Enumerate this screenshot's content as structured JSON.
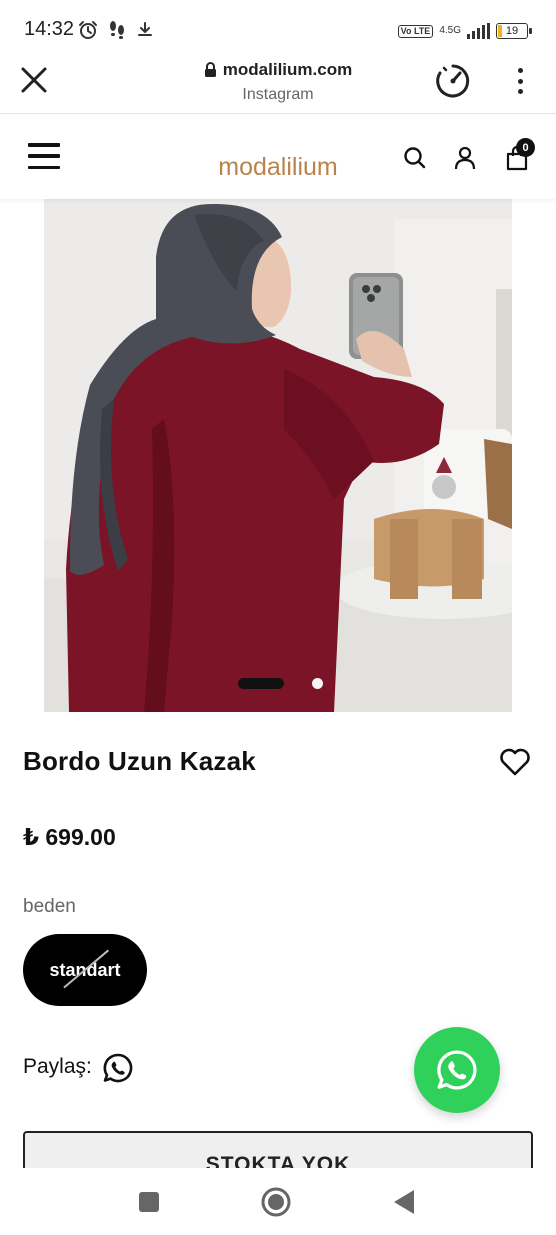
{
  "status_bar": {
    "time": "14:32",
    "network_label": "4.5G",
    "volte_label": "Vo LTE",
    "battery": "19"
  },
  "browser": {
    "domain": "modalilium.com",
    "subtitle": "Instagram"
  },
  "site": {
    "logo_text": "modalilium",
    "cart_count": "0",
    "brand_color": "#b9844c"
  },
  "product": {
    "title": "Bordo Uzun Kazak",
    "price": "₺ 699.00",
    "size_label": "beden",
    "size_option": "standart",
    "size_available": false,
    "share_label": "Paylaş:",
    "stock_button": "STOKTA YOK",
    "image_count": 2,
    "active_image": 1
  },
  "colors": {
    "whatsapp": "#2fd15b",
    "sweater": "#7a1426",
    "hijab": "#4a4d55"
  }
}
